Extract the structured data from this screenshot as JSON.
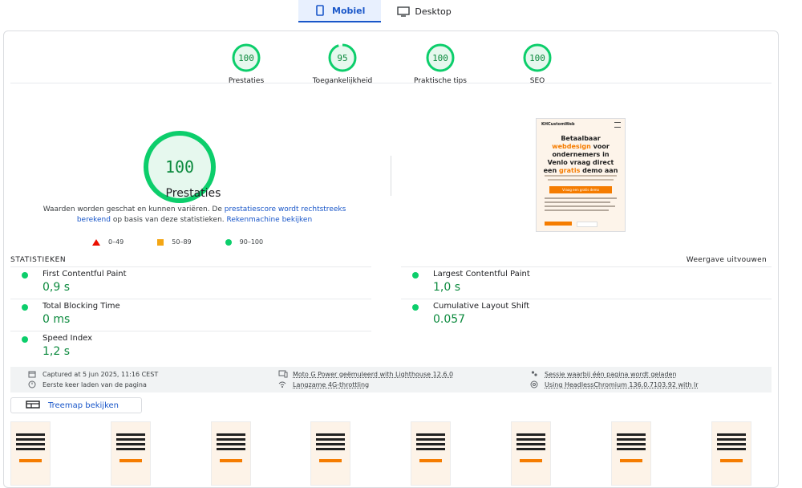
{
  "device_tabs": [
    {
      "label": "Mobiel",
      "icon": "phone-icon",
      "active": true
    },
    {
      "label": "Desktop",
      "icon": "monitor-icon",
      "active": false
    }
  ],
  "scores": [
    {
      "value": "100",
      "label": "Prestaties",
      "fraction": 1.0
    },
    {
      "value": "95",
      "label": "Toegankelijkheid",
      "fraction": 0.95
    },
    {
      "value": "100",
      "label": "Praktische tips",
      "fraction": 1.0
    },
    {
      "value": "100",
      "label": "SEO",
      "fraction": 1.0
    }
  ],
  "main_score": {
    "value": "100",
    "title": "Prestaties",
    "desc_1": "Waarden worden geschat en kunnen variëren. De ",
    "desc_link_1": "prestatiescore wordt rechtstreeks berekend",
    "desc_2": " op basis van deze statistieken. ",
    "desc_link_2": "Rekenmachine bekijken"
  },
  "legend": [
    {
      "label": "0–49",
      "shape": "triangle",
      "color": "#eb0f00"
    },
    {
      "label": "50–89",
      "shape": "square",
      "color": "#f4a614"
    },
    {
      "label": "90–100",
      "shape": "circle",
      "color": "#0cce6b"
    }
  ],
  "preview": {
    "brand": "KHCustomWeb",
    "headline_1": "Betaalbaar",
    "headline_accent": "webdesign",
    "headline_2": "voor ondernemers in Venlo vraag direct een",
    "headline_accent_2": "gratis",
    "headline_3": "demo aan",
    "cta": "Vraag een gratis demo"
  },
  "stats": {
    "title": "STATISTIEKEN",
    "expand_label": "Weergave uitvouwen",
    "metrics": [
      {
        "name": "First Contentful Paint",
        "value": "0,9 s"
      },
      {
        "name": "Largest Contentful Paint",
        "value": "1,0 s"
      },
      {
        "name": "Total Blocking Time",
        "value": "0 ms"
      },
      {
        "name": "Cumulative Layout Shift",
        "value": "0.057"
      },
      {
        "name": "Speed Index",
        "value": "1,2 s"
      }
    ]
  },
  "info": {
    "captured": "Captured at 5 jun 2025, 11:16 CEST",
    "first_load": "Eerste keer laden van de pagina",
    "device": "Moto G Power geëmuleerd with Lighthouse 12.6.0",
    "throttling": "Langzame 4G-throttling",
    "session": "Sessie waarbij één pagina wordt geladen",
    "browser": "Using HeadlessChromium 136.0.7103.92 with lr"
  },
  "treemap_label": "Treemap bekijken",
  "colors": {
    "good": "#0cce6b",
    "good_text": "#0c8a3e",
    "accent": "#1a57c9",
    "brand_orange": "#f57c00"
  }
}
